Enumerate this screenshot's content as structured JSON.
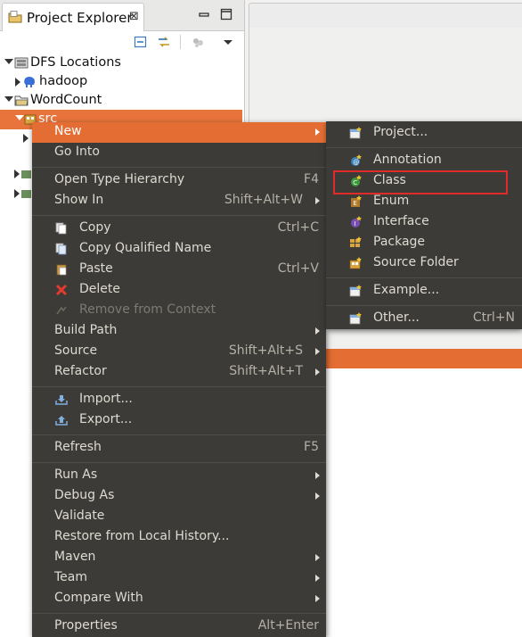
{
  "explorer": {
    "tab_title": "Project Explorer",
    "tab_close": "⊠",
    "tree": [
      {
        "label": "DFS Locations",
        "expanded": true,
        "icon": "dfs-locations-icon"
      },
      {
        "label": "hadoop",
        "expanded": false,
        "icon": "hadoop-elephant-icon"
      },
      {
        "label": "WordCount",
        "expanded": true,
        "icon": "project-folder-icon"
      },
      {
        "label": "src",
        "expanded": true,
        "icon": "package-folder-icon",
        "selected": true
      }
    ]
  },
  "context_menu": {
    "items": [
      {
        "label": "New",
        "submenu": true,
        "active": true
      },
      {
        "label": "Go Into"
      },
      {
        "label": "Open Type Hierarchy",
        "accel": "F4"
      },
      {
        "label": "Show In",
        "accel": "Shift+Alt+W",
        "submenu": true
      },
      {
        "label": "Copy",
        "accel": "Ctrl+C",
        "icon": "copy-icon"
      },
      {
        "label": "Copy Qualified Name",
        "icon": "copy-qualified-name-icon"
      },
      {
        "label": "Paste",
        "accel": "Ctrl+V",
        "icon": "paste-icon"
      },
      {
        "label": "Delete",
        "icon": "delete-icon"
      },
      {
        "label": "Remove from Context",
        "disabled": true,
        "icon": "remove-context-icon"
      },
      {
        "label": "Build Path",
        "submenu": true
      },
      {
        "label": "Source",
        "accel": "Shift+Alt+S",
        "submenu": true
      },
      {
        "label": "Refactor",
        "accel": "Shift+Alt+T",
        "submenu": true
      },
      {
        "label": "Import...",
        "icon": "import-icon"
      },
      {
        "label": "Export...",
        "icon": "export-icon"
      },
      {
        "label": "Refresh",
        "accel": "F5"
      },
      {
        "label": "Run As",
        "submenu": true
      },
      {
        "label": "Debug As",
        "submenu": true
      },
      {
        "label": "Validate"
      },
      {
        "label": "Restore from Local History..."
      },
      {
        "label": "Maven",
        "submenu": true
      },
      {
        "label": "Team",
        "submenu": true
      },
      {
        "label": "Compare With",
        "submenu": true
      },
      {
        "label": "Properties",
        "accel": "Alt+Enter"
      }
    ]
  },
  "submenu": {
    "items": [
      {
        "label": "Project...",
        "icon": "new-project-icon"
      },
      {
        "label": "Annotation",
        "icon": "annotation-icon"
      },
      {
        "label": "Class",
        "icon": "class-icon",
        "highlighted": true
      },
      {
        "label": "Enum",
        "icon": "enum-icon"
      },
      {
        "label": "Interface",
        "icon": "interface-icon"
      },
      {
        "label": "Package",
        "icon": "package-icon"
      },
      {
        "label": "Source Folder",
        "icon": "source-folder-icon"
      },
      {
        "label": "Example...",
        "icon": "example-icon"
      },
      {
        "label": "Other...",
        "accel": "Ctrl+N",
        "icon": "other-wizard-icon"
      }
    ]
  },
  "colors": {
    "menu_bg": "#3c3b37",
    "menu_text": "#dfdbd2",
    "accent_orange": "#e46d33",
    "highlight_red": "#e02b2b"
  }
}
